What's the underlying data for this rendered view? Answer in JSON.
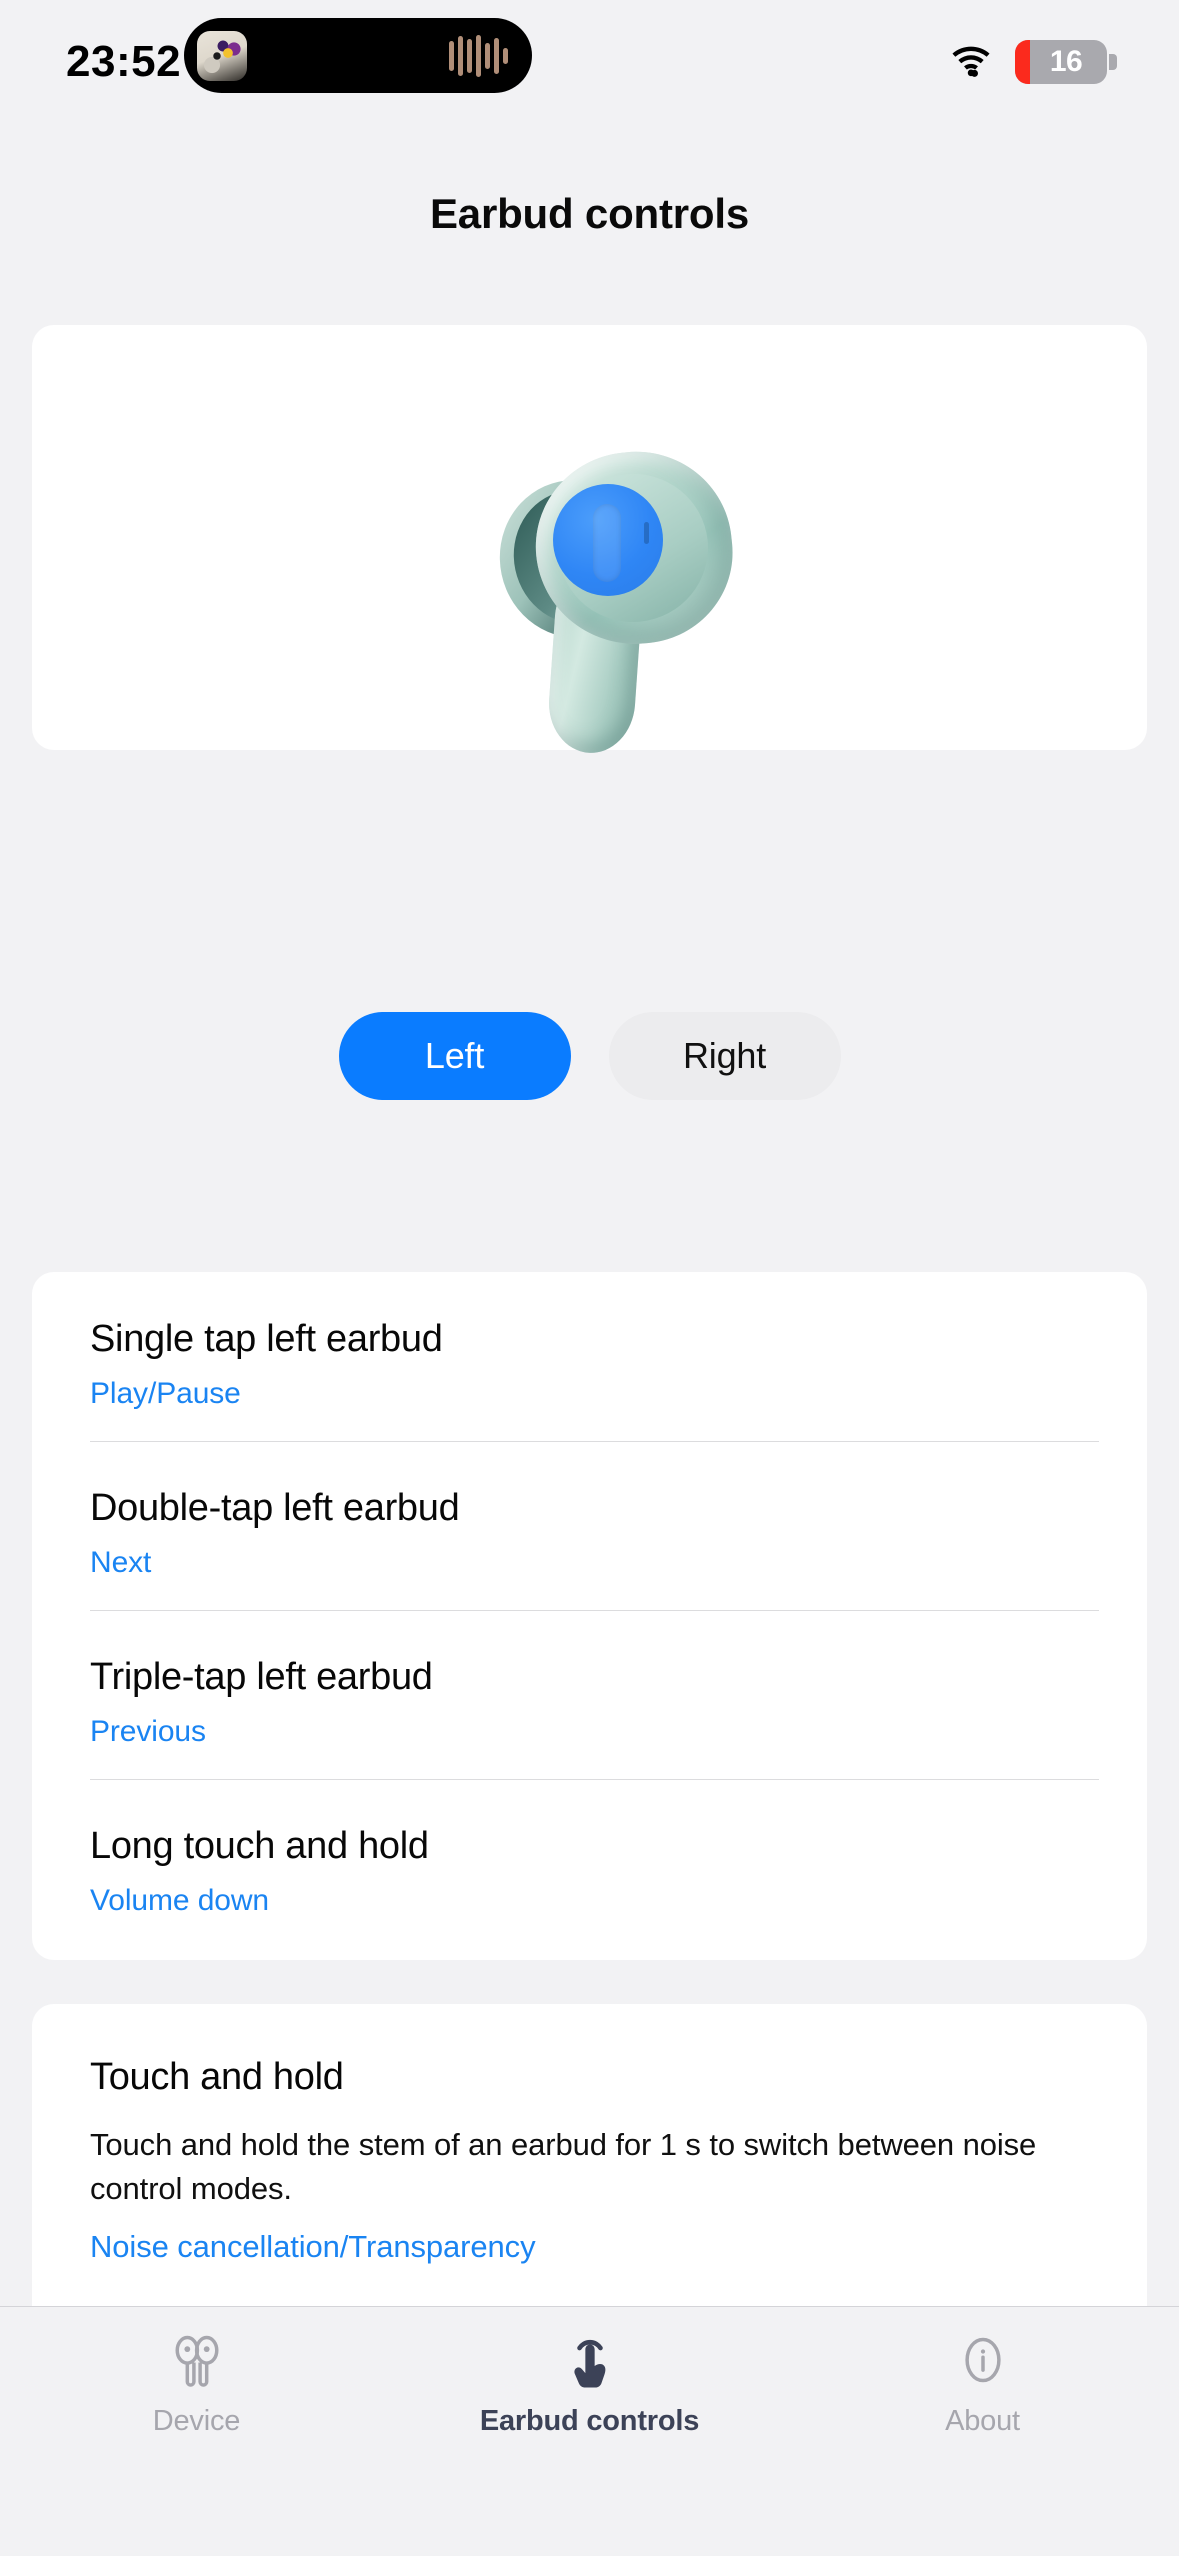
{
  "status_bar": {
    "time": "23:52",
    "battery_percent": "16",
    "battery_level_pct": 16,
    "battery_color": "#fb2a1d",
    "wifi_icon": "wifi-icon",
    "dynamic_island": {
      "album_art_icon": "album-art-thumbnail",
      "audio_waveform_icon": "audio-waveform-icon"
    }
  },
  "header": {
    "title": "Earbud controls"
  },
  "earbud_card": {
    "earbud_image_name": "earbud-illustration",
    "touch_area_color": "#2f86f5",
    "earbud_body_color": "#b7d8ce",
    "side_selector": {
      "options": [
        "Left",
        "Right"
      ],
      "selected": "Left",
      "active_color": "#0a7cff",
      "inactive_color": "#ececee"
    }
  },
  "controls_list": {
    "rows": [
      {
        "title": "Single tap left earbud",
        "value": "Play/Pause"
      },
      {
        "title": "Double-tap left earbud",
        "value": "Next"
      },
      {
        "title": "Triple-tap left earbud",
        "value": "Previous"
      },
      {
        "title": "Long touch and hold",
        "value": "Volume down"
      }
    ],
    "value_color": "#1a84f2"
  },
  "touch_and_hold": {
    "title": "Touch and hold",
    "description": "Touch and hold the stem of an earbud for 1 s to switch between noise control modes.",
    "value": "Noise cancellation/Transparency"
  },
  "tab_bar": {
    "tabs": [
      {
        "label": "Device",
        "icon": "earbuds-icon",
        "active": false
      },
      {
        "label": "Earbud controls",
        "icon": "tap-gesture-icon",
        "active": true
      },
      {
        "label": "About",
        "icon": "info-circle-icon",
        "active": false
      }
    ],
    "active_color": "#3c4257",
    "inactive_color": "#a6a6ad"
  }
}
